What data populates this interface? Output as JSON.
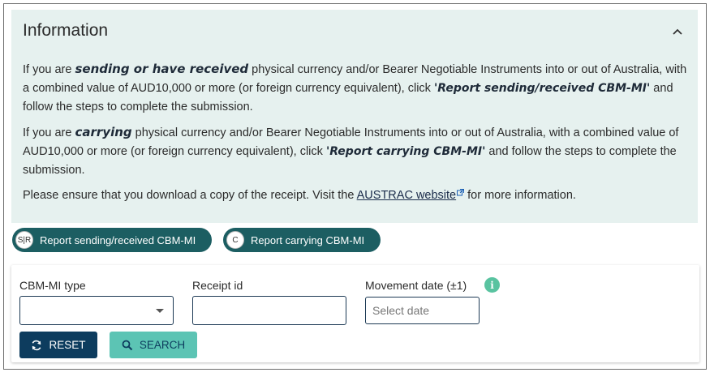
{
  "info": {
    "title": "Information",
    "p1": {
      "t1": "If you are ",
      "b1": "sending or have received",
      "t2": " physical currency and/or Bearer Negotiable Instruments into or out of Australia, with a combined value of AUD10,000 or more (or foreign currency equivalent), click ",
      "b2": "'Report sending/received CBM-MI'",
      "t3": " and follow the steps to complete the submission."
    },
    "p2": {
      "t1": "If you are ",
      "b1": "carrying",
      "t2": " physical currency and/or Bearer Negotiable Instruments into or out of Australia, with a combined value of AUD10,000 or more (or foreign currency equivalent), click ",
      "b2": "'Report carrying CBM-MI'",
      "t3": " and follow the steps to complete the submission."
    },
    "p3": {
      "t1": "Please ensure that you download a copy of the receipt. Visit the ",
      "link": "AUSTRAC website",
      "t2": " for more information."
    }
  },
  "actions": {
    "report_sending": {
      "badge": "S|R",
      "label": "Report sending/received CBM-MI"
    },
    "report_carrying": {
      "badge": "C",
      "label": "Report carrying CBM-MI"
    }
  },
  "search": {
    "cbm_type_label": "CBM-MI type",
    "cbm_type_value": "",
    "receipt_label": "Receipt id",
    "receipt_value": "",
    "movement_label": "Movement date (±1)",
    "movement_info": "i",
    "movement_placeholder": "Select date",
    "reset_label": "RESET",
    "search_label": "SEARCH"
  },
  "colors": {
    "panel_bg": "#e6f1ef",
    "pill_bg": "#1c5e62",
    "reset_bg": "#0d3c5e",
    "search_bg": "#5cc4b4",
    "info_dot": "#59c3a0"
  }
}
